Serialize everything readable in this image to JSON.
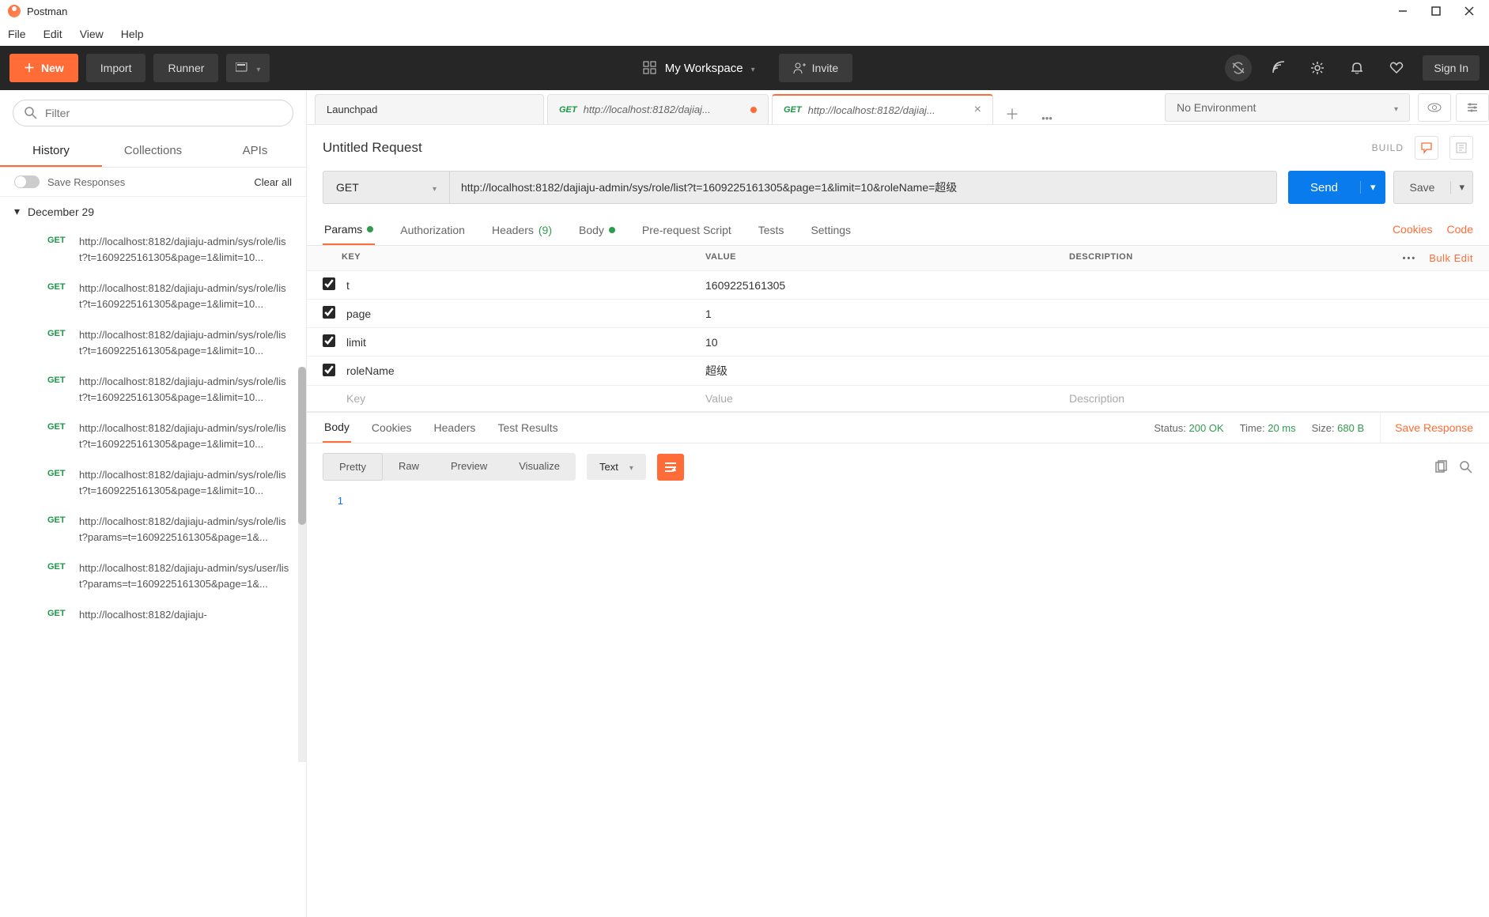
{
  "app": {
    "title": "Postman"
  },
  "menu": [
    "File",
    "Edit",
    "View",
    "Help"
  ],
  "toolbar": {
    "new": "New",
    "import": "Import",
    "runner": "Runner",
    "workspace": "My Workspace",
    "invite": "Invite",
    "signin": "Sign In"
  },
  "sidebar": {
    "filter_placeholder": "Filter",
    "tabs": [
      "History",
      "Collections",
      "APIs"
    ],
    "active_tab": 0,
    "save_responses": "Save Responses",
    "clear_all": "Clear all",
    "date_header": "December 29",
    "history": [
      {
        "method": "GET",
        "url": "http://localhost:8182/dajiaju-admin/sys/role/list?t=1609225161305&page=1&limit=10..."
      },
      {
        "method": "GET",
        "url": "http://localhost:8182/dajiaju-admin/sys/role/list?t=1609225161305&page=1&limit=10..."
      },
      {
        "method": "GET",
        "url": "http://localhost:8182/dajiaju-admin/sys/role/list?t=1609225161305&page=1&limit=10..."
      },
      {
        "method": "GET",
        "url": "http://localhost:8182/dajiaju-admin/sys/role/list?t=1609225161305&page=1&limit=10..."
      },
      {
        "method": "GET",
        "url": "http://localhost:8182/dajiaju-admin/sys/role/list?t=1609225161305&page=1&limit=10..."
      },
      {
        "method": "GET",
        "url": "http://localhost:8182/dajiaju-admin/sys/role/list?t=1609225161305&page=1&limit=10..."
      },
      {
        "method": "GET",
        "url": "http://localhost:8182/dajiaju-admin/sys/role/list?params=t=1609225161305&page=1&..."
      },
      {
        "method": "GET",
        "url": "http://localhost:8182/dajiaju-admin/sys/user/list?params=t=1609225161305&page=1&..."
      },
      {
        "method": "GET",
        "url": "http://localhost:8182/dajiaju-"
      }
    ]
  },
  "request": {
    "tabs": [
      {
        "title": "Launchpad"
      },
      {
        "method": "GET",
        "title": "http://localhost:8182/dajiaj...",
        "modified": true
      },
      {
        "method": "GET",
        "title": "http://localhost:8182/dajiaj...",
        "active": true
      }
    ],
    "name": "Untitled Request",
    "build": "BUILD",
    "method": "GET",
    "url": "http://localhost:8182/dajiaju-admin/sys/role/list?t=1609225161305&page=1&limit=10&roleName=超级",
    "send": "Send",
    "save": "Save",
    "env": "No Environment"
  },
  "sub_tabs": {
    "items": [
      "Params",
      "Authorization",
      "Headers",
      "Body",
      "Pre-request Script",
      "Tests",
      "Settings"
    ],
    "headers_count": "(9)",
    "cookies": "Cookies",
    "code": "Code"
  },
  "params": {
    "head": {
      "key": "KEY",
      "value": "VALUE",
      "desc": "DESCRIPTION",
      "bulk": "Bulk Edit"
    },
    "rows": [
      {
        "key": "t",
        "value": "1609225161305"
      },
      {
        "key": "page",
        "value": "1"
      },
      {
        "key": "limit",
        "value": "10"
      },
      {
        "key": "roleName",
        "value": "超级"
      }
    ],
    "placeholders": {
      "key": "Key",
      "value": "Value",
      "desc": "Description"
    }
  },
  "response": {
    "tabs": [
      "Body",
      "Cookies",
      "Headers",
      "Test Results"
    ],
    "status_label": "Status:",
    "status": "200 OK",
    "time_label": "Time:",
    "time": "20 ms",
    "size_label": "Size:",
    "size": "680 B",
    "save_response": "Save Response",
    "view_modes": [
      "Pretty",
      "Raw",
      "Preview",
      "Visualize"
    ],
    "type": "Text",
    "body_line_num": "1"
  }
}
